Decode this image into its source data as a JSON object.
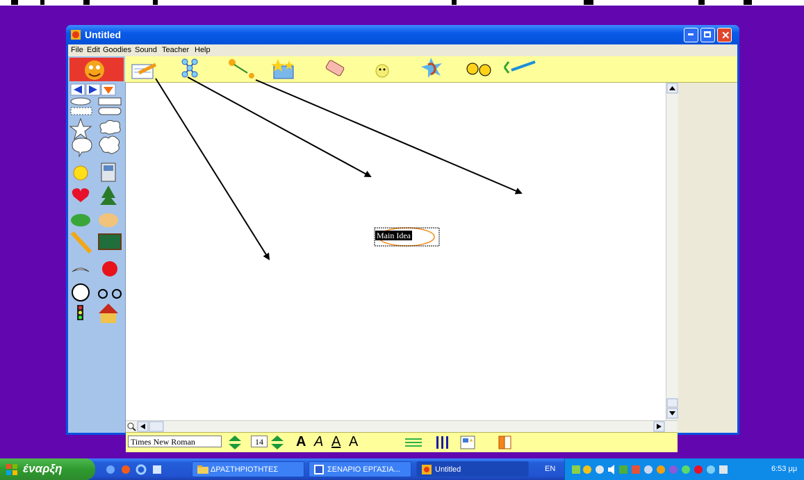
{
  "window": {
    "title": "Untitled",
    "menu": [
      "File",
      "Edit",
      "Goodies",
      "Sound",
      "Teacher",
      "Help"
    ]
  },
  "toolbar": {
    "tools": [
      "pencil-paper-icon",
      "web-map-icon",
      "link-arrow-icon",
      "goodies-box-icon",
      "eraser-icon",
      "sound-record-icon",
      "listen-ear-icon",
      "faces-icon",
      "paint-brush-icon"
    ]
  },
  "canvas": {
    "main_idea_label": "Main Idea"
  },
  "format_bar": {
    "font_name": "Times New Roman",
    "font_size": "14",
    "bold_label": "A",
    "italic_label": "A",
    "underline_label": "A",
    "size_style_label": "A"
  },
  "taskbar": {
    "start_label": "έναρξη",
    "tasks": [
      "ΔΡΑΣΤΗΡΙΟΤΗΤΕΣ",
      "ΣΕΝΑΡΙΟ ΕΡΓΑΣΙΑ...",
      "Untitled"
    ],
    "language": "EN",
    "clock": "6:53 μμ"
  },
  "colors": {
    "desktop": "#6207b0",
    "toolbar": "#fefe9a",
    "panel": "#a6c4ea",
    "titlebar": "#0a5ae8"
  }
}
